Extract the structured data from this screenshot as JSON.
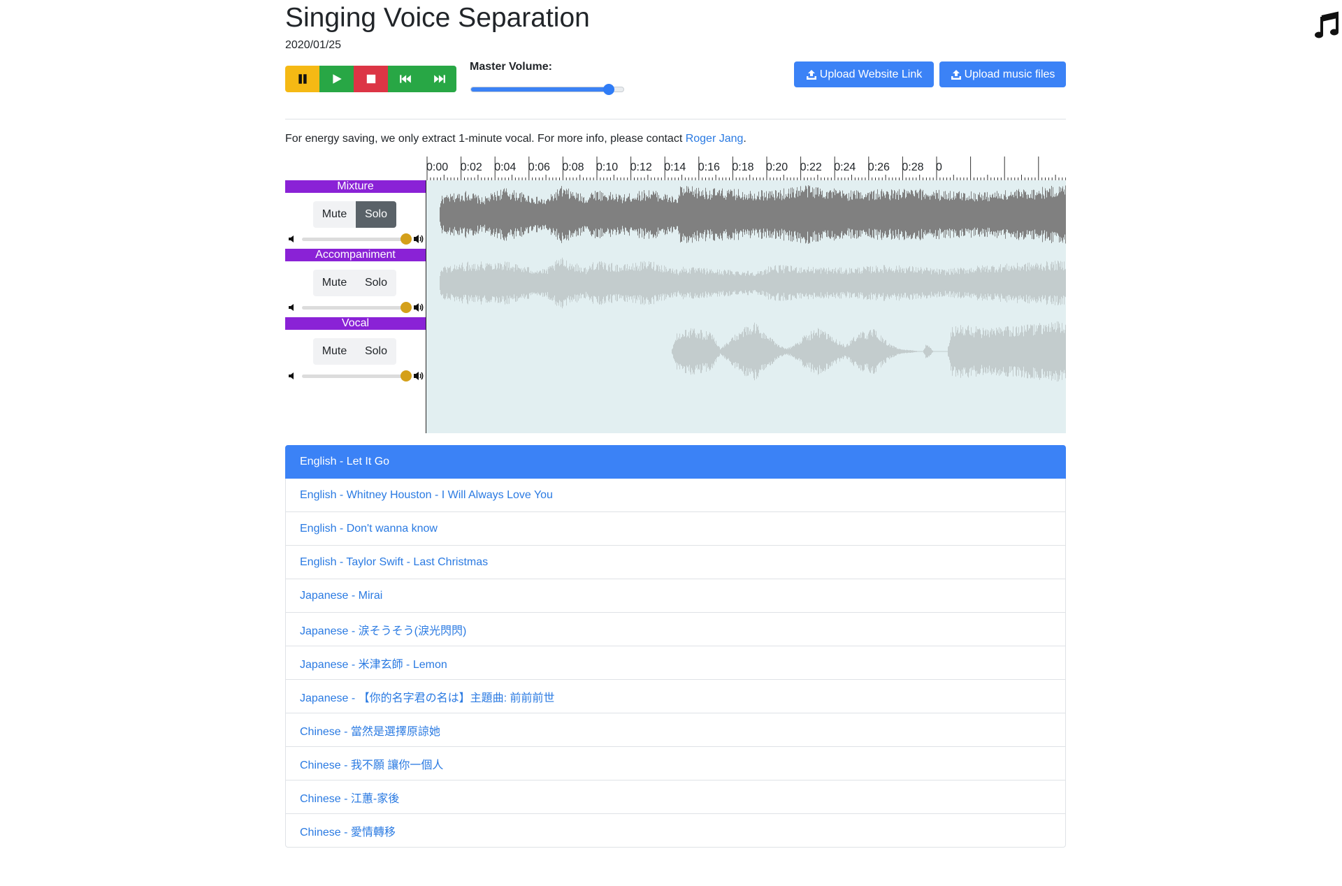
{
  "page": {
    "title": "Singing Voice Separation",
    "date": "2020/01/25"
  },
  "transport": {
    "buttons": [
      {
        "icon": "pause-icon",
        "color": "#f5b914"
      },
      {
        "icon": "play-icon",
        "color": "#28a745"
      },
      {
        "icon": "stop-icon",
        "color": "#dc3545"
      },
      {
        "icon": "skip-back-icon",
        "color": "#28a745"
      },
      {
        "icon": "skip-forward-icon",
        "color": "#28a745"
      }
    ]
  },
  "master_volume": {
    "label": "Master Volume:",
    "value": 0.9
  },
  "upload": {
    "link_label": "Upload Website Link",
    "files_label": "Upload music files"
  },
  "info": {
    "text": "For energy saving, we only extract 1-minute vocal. For more info, please contact ",
    "link": "Roger Jang",
    "suffix": "."
  },
  "timeline": {
    "labels": [
      "0:00",
      "0:02",
      "0:04",
      "0:06",
      "0:08",
      "0:10",
      "0:12",
      "0:14",
      "0:16",
      "0:18",
      "0:20",
      "0:22",
      "0:24",
      "0:26",
      "0:28",
      "0"
    ]
  },
  "tracks": [
    {
      "name": "Mixture",
      "mute_label": "Mute",
      "solo_label": "Solo",
      "solo_active": true,
      "volume": 1.0,
      "wave_color": "#808080"
    },
    {
      "name": "Accompaniment",
      "mute_label": "Mute",
      "solo_label": "Solo",
      "solo_active": false,
      "volume": 1.0,
      "wave_color": "#c3cccd"
    },
    {
      "name": "Vocal",
      "mute_label": "Mute",
      "solo_label": "Solo",
      "solo_active": false,
      "volume": 1.0,
      "wave_color": "#c3cccd"
    }
  ],
  "playlist": {
    "active_index": 0,
    "items": [
      "English - Let It Go",
      "English - Whitney Houston - I Will Always Love You",
      "English - Don't wanna know",
      "English - Taylor Swift - Last Christmas",
      "Japanese - Mirai",
      "Japanese - 涙そうそう(淚光閃閃)",
      "Japanese - 米津玄師 - Lemon",
      "Japanese - 【你的名字君の名は】主題曲: 前前前世",
      "Chinese - 當然是選擇原諒她",
      "Chinese - 我不願 讓你一個人",
      "Chinese - 江蕙-家後",
      "Chinese - 愛情轉移"
    ]
  },
  "colors": {
    "accent": "#3b82f6",
    "track_label_bg": "#8a22d6",
    "wave_bg": "#e2eff1",
    "link": "#2a7ae2"
  }
}
